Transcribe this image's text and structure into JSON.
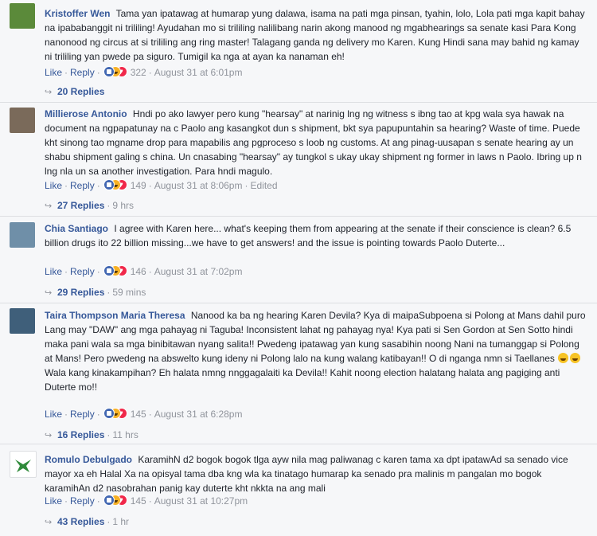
{
  "comments": [
    {
      "author": "Kristoffer Wen",
      "text": "Tama yan ipatawag at humarap yung dalawa, isama na pati mga pinsan, tyahin, lolo, Lola pati mga kapit bahay na ipababanggit ni trililing! Ayudahan mo si trililing nalilibang narin akong manood ng mgabhearings sa senate kasi Para Kong nanonood ng circus at si trililing ang ring master! Talagang ganda ng delivery mo Karen. Kung Hindi sana may bahid ng kamay ni trililing yan pwede pa siguro. Tumigil ka nga at ayan ka nanaman eh!",
      "like": "Like",
      "reply": "Reply",
      "reactions": "322",
      "date": "August 31 at 6:01pm",
      "edited": "",
      "replies": "20 Replies",
      "reply_time": "",
      "avatar_color": "#5b8a3a"
    },
    {
      "author": "Millierose Antonio",
      "text": "Hndi po ako lawyer pero kung \"hearsay\" at narinig lng ng witness s ibng tao at kpg wala sya hawak na document na ngpapatunay na c Paolo ang kasangkot dun s shipment, bkt sya papupuntahin sa hearing? Waste of time. Puede kht sinong tao mgname drop para mapabilis ang pgproceso s loob ng customs. At ang pinag-uusapan s senate hearing ay un shabu shipment galing s china. Un cnasabing \"hearsay\" ay tungkol s ukay ukay shipment ng former in laws n Paolo. Ibring up n lng nla un sa another investigation. Para hndi magulo.",
      "like": "Like",
      "reply": "Reply",
      "reactions": "149",
      "date": "August 31 at 8:06pm",
      "edited": "Edited",
      "replies": "27 Replies",
      "reply_time": "9 hrs",
      "avatar_color": "#7a6a5a"
    },
    {
      "author": "Chia Santiago",
      "text": "I agree with Karen here... what's keeping them from appearing at the senate if their conscience is clean? 6.5 billion drugs ito 22 billion missing...we have to get answers! and the issue is pointing towards Paolo Duterte...",
      "like": "Like",
      "reply": "Reply",
      "reactions": "146",
      "date": "August 31 at 7:02pm",
      "edited": "",
      "replies": "29 Replies",
      "reply_time": "59 mins",
      "avatar_color": "#6f8fa8"
    },
    {
      "author": "Taira Thompson Maria Theresa",
      "text": "Nanood ka ba ng hearing Karen Devila? Kya di maipaSubpoena si Polong at Mans dahil puro Lang may \"DAW\" ang mga pahayag ni Taguba! Inconsistent lahat ng pahayag nya! Kya pati si Sen Gordon at Sen Sotto hindi maka pani wala sa mga binibitawan nyang salita!! Pwedeng ipatawag yan kung sasabihin noong Nani na tumanggap si Polong at Mans! Pero pwedeng na abswelto kung ideny ni Polong lalo na kung walang katibayan!! O di nganga nmn si Taellanes",
      "text2": "Wala kang kinakampihan? Eh halata nmng nnggagalaiti ka Devila!! Kahit noong election halatang halata ang pagiging anti Duterte mo!!",
      "like": "Like",
      "reply": "Reply",
      "reactions": "145",
      "date": "August 31 at 6:28pm",
      "edited": "",
      "replies": "16 Replies",
      "reply_time": "11 hrs",
      "avatar_color": "#3f5f7a"
    },
    {
      "author": "Romulo Debulgado",
      "text": "KaramihN d2 bogok bogok tlga ayw nila mag paliwanag c karen tama xa dpt ipatawAd sa senado vice mayor xa eh Halal Xa na opisyal tama dba kng wla ka tinatago humarap ka senado pra malinis m pangalan mo bogok karamihAn d2 nasobrahan panig kay duterte kht nkkta na ang mali",
      "like": "Like",
      "reply": "Reply",
      "reactions": "145",
      "date": "August 31 at 10:27pm",
      "edited": "",
      "replies": "43 Replies",
      "reply_time": "1 hr",
      "avatar_color": "#2f8a3a"
    }
  ]
}
